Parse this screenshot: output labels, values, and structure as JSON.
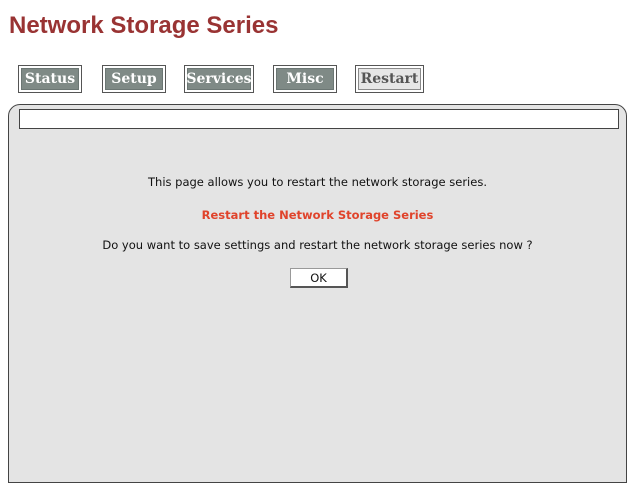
{
  "page": {
    "title": "Network Storage Series"
  },
  "nav": {
    "tabs": [
      {
        "label": "Status"
      },
      {
        "label": "Setup"
      },
      {
        "label": "Services"
      },
      {
        "label": "Misc"
      },
      {
        "label": "Restart"
      }
    ],
    "active_tab": "Restart"
  },
  "content": {
    "intro": "This page allows you to restart the network storage series.",
    "heading": "Restart the Network Storage Series",
    "question": "Do you want to save settings and restart the network storage series now ?",
    "ok_label": "OK"
  },
  "colors": {
    "title": "#993333",
    "heading": "#e0432b",
    "tab_background": "#7f8a86",
    "panel_background": "#e4e4e4"
  }
}
